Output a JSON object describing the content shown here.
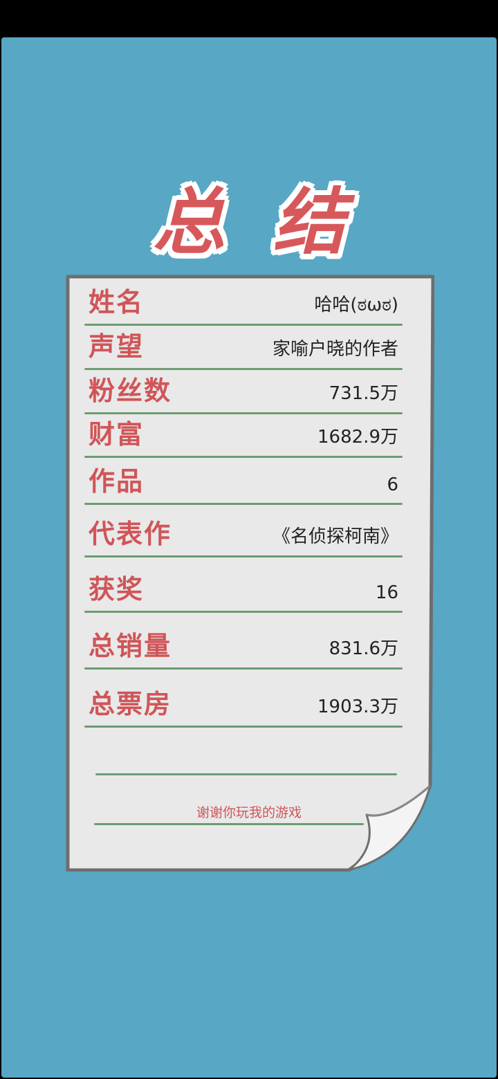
{
  "title": "总结",
  "rows": [
    {
      "label": "姓名",
      "value": "哈哈(ಠωಠ)"
    },
    {
      "label": "声望",
      "value": "家喻户晓的作者"
    },
    {
      "label": "粉丝数",
      "value": "731.5万"
    },
    {
      "label": "财富",
      "value": "1682.9万"
    },
    {
      "label": "作品",
      "value": "6"
    },
    {
      "label": "代表作",
      "value": "《名侦探柯南》"
    },
    {
      "label": "获奖",
      "value": "16"
    },
    {
      "label": "总销量",
      "value": "831.6万"
    },
    {
      "label": "总票房",
      "value": "1903.3万"
    }
  ],
  "thanks": "谢谢你玩我的游戏",
  "colors": {
    "background": "#57a7c5",
    "accent_red": "#d05558",
    "rule_green": "#6b9c6f",
    "paper": "#e9e9e9"
  }
}
